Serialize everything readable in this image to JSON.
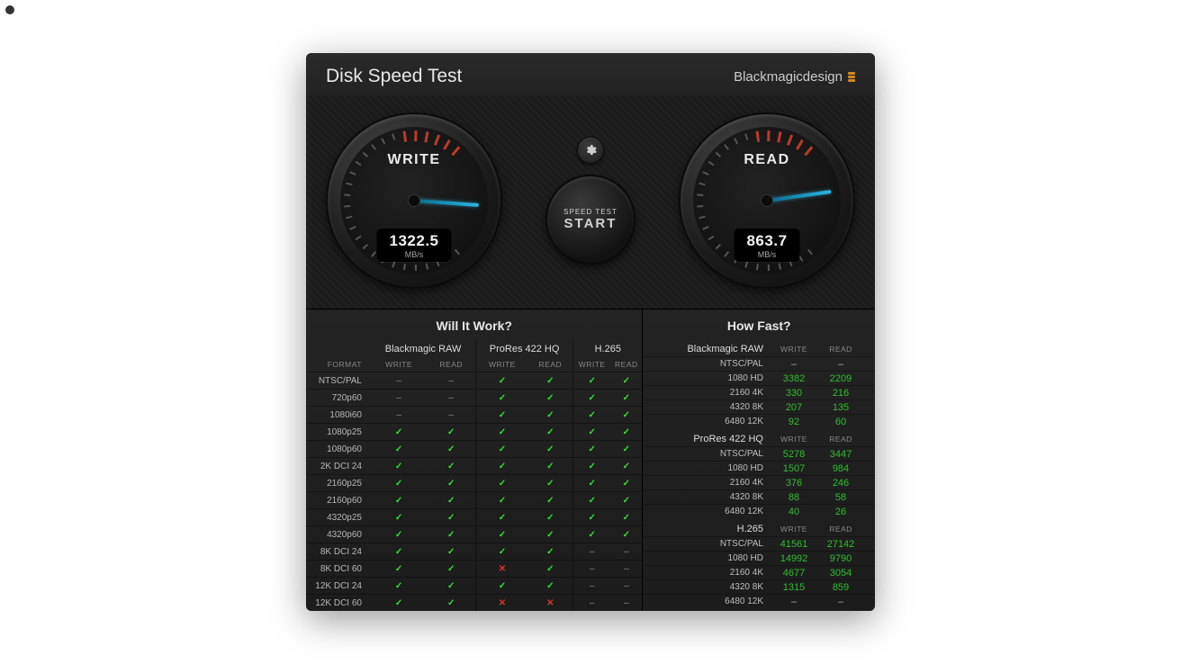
{
  "app_title": "Disk Speed Test",
  "brand": "Blackmagicdesign",
  "gauges": {
    "write": {
      "label": "WRITE",
      "value": "1322.5",
      "unit": "MB/s",
      "needle_deg": 184
    },
    "read": {
      "label": "READ",
      "value": "863.7",
      "unit": "MB/s",
      "needle_deg": 172
    }
  },
  "center": {
    "speedtest_label": "SPEED TEST",
    "start_label": "START"
  },
  "left_panel": {
    "title": "Will It Work?",
    "format_header": "FORMAT",
    "groups": [
      "Blackmagic RAW",
      "ProRes 422 HQ",
      "H.265"
    ],
    "sub_cols": [
      "WRITE",
      "READ"
    ],
    "rows": [
      {
        "fmt": "NTSC/PAL",
        "cells": [
          "dash",
          "dash",
          "chk",
          "chk",
          "chk",
          "chk"
        ]
      },
      {
        "fmt": "720p60",
        "cells": [
          "dash",
          "dash",
          "chk",
          "chk",
          "chk",
          "chk"
        ]
      },
      {
        "fmt": "1080i60",
        "cells": [
          "dash",
          "dash",
          "chk",
          "chk",
          "chk",
          "chk"
        ]
      },
      {
        "fmt": "1080p25",
        "cells": [
          "chk",
          "chk",
          "chk",
          "chk",
          "chk",
          "chk"
        ]
      },
      {
        "fmt": "1080p60",
        "cells": [
          "chk",
          "chk",
          "chk",
          "chk",
          "chk",
          "chk"
        ]
      },
      {
        "fmt": "2K DCI 24",
        "cells": [
          "chk",
          "chk",
          "chk",
          "chk",
          "chk",
          "chk"
        ]
      },
      {
        "fmt": "2160p25",
        "cells": [
          "chk",
          "chk",
          "chk",
          "chk",
          "chk",
          "chk"
        ]
      },
      {
        "fmt": "2160p60",
        "cells": [
          "chk",
          "chk",
          "chk",
          "chk",
          "chk",
          "chk"
        ]
      },
      {
        "fmt": "4320p25",
        "cells": [
          "chk",
          "chk",
          "chk",
          "chk",
          "chk",
          "chk"
        ]
      },
      {
        "fmt": "4320p60",
        "cells": [
          "chk",
          "chk",
          "chk",
          "chk",
          "chk",
          "chk"
        ]
      },
      {
        "fmt": "8K DCI 24",
        "cells": [
          "chk",
          "chk",
          "chk",
          "chk",
          "dash",
          "dash"
        ]
      },
      {
        "fmt": "8K DCI 60",
        "cells": [
          "chk",
          "chk",
          "x",
          "chk",
          "dash",
          "dash"
        ]
      },
      {
        "fmt": "12K DCI 24",
        "cells": [
          "chk",
          "chk",
          "chk",
          "chk",
          "dash",
          "dash"
        ]
      },
      {
        "fmt": "12K DCI 60",
        "cells": [
          "chk",
          "chk",
          "x",
          "x",
          "dash",
          "dash"
        ]
      }
    ]
  },
  "right_panel": {
    "title": "How Fast?",
    "sub_cols": [
      "WRITE",
      "READ"
    ],
    "sections": [
      {
        "name": "Blackmagic RAW",
        "rows": [
          {
            "res": "NTSC/PAL",
            "write": "–",
            "read": "–",
            "dash": true
          },
          {
            "res": "1080 HD",
            "write": "3382",
            "read": "2209"
          },
          {
            "res": "2160 4K",
            "write": "330",
            "read": "216"
          },
          {
            "res": "4320 8K",
            "write": "207",
            "read": "135"
          },
          {
            "res": "6480 12K",
            "write": "92",
            "read": "60"
          }
        ]
      },
      {
        "name": "ProRes 422 HQ",
        "rows": [
          {
            "res": "NTSC/PAL",
            "write": "5278",
            "read": "3447"
          },
          {
            "res": "1080 HD",
            "write": "1507",
            "read": "984"
          },
          {
            "res": "2160 4K",
            "write": "376",
            "read": "246"
          },
          {
            "res": "4320 8K",
            "write": "88",
            "read": "58"
          },
          {
            "res": "6480 12K",
            "write": "40",
            "read": "26"
          }
        ]
      },
      {
        "name": "H.265",
        "rows": [
          {
            "res": "NTSC/PAL",
            "write": "41561",
            "read": "27142"
          },
          {
            "res": "1080 HD",
            "write": "14992",
            "read": "9790"
          },
          {
            "res": "2160 4K",
            "write": "4677",
            "read": "3054"
          },
          {
            "res": "4320 8K",
            "write": "1315",
            "read": "859"
          },
          {
            "res": "6480 12K",
            "write": "–",
            "read": "–",
            "dash": true
          }
        ]
      }
    ]
  }
}
